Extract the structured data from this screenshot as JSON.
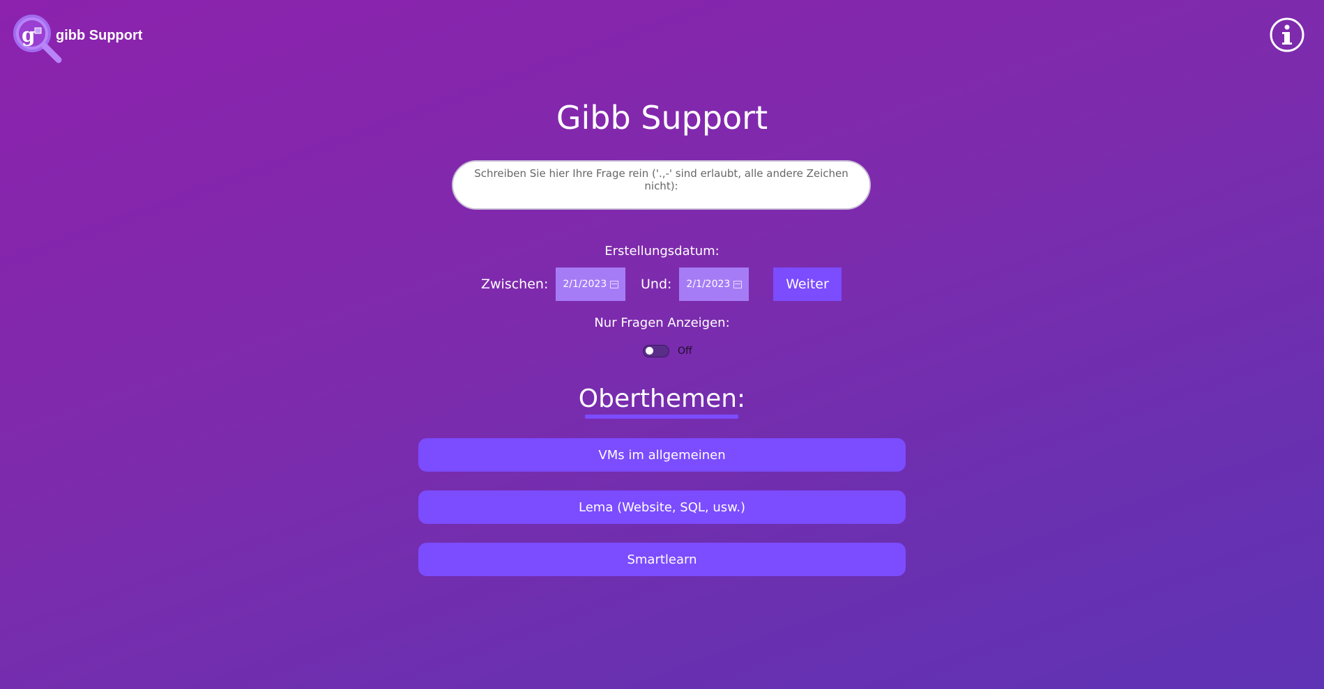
{
  "header": {
    "logo_text": "gibb Support",
    "logo_letter": "g",
    "info_icon": "info-circle-icon"
  },
  "main": {
    "title": "Gibb Support",
    "question_placeholder": "Schreiben Sie hier Ihre Frage rein ('.,-' sind erlaubt, alle andere Zeichen nicht):",
    "date_label": "Erstellungsdatum:",
    "between_label": "Zwischen:",
    "from_date": "2/1/2023",
    "and_label": "Und:",
    "to_date": "2/1/2023",
    "submit_label": "Weiter",
    "only_questions_label": "Nur Fragen Anzeigen:",
    "toggle_state": "Off",
    "topics_heading": "Oberthemen:",
    "topics": [
      {
        "label": "VMs im allgemeinen"
      },
      {
        "label": "Lema (Website, SQL, usw.)"
      },
      {
        "label": "Smartlearn"
      }
    ]
  },
  "colors": {
    "background_start": "#8c22ad",
    "background_end": "#5f33b5",
    "accent": "#7c4cff",
    "date_field": "#a67cf6"
  }
}
